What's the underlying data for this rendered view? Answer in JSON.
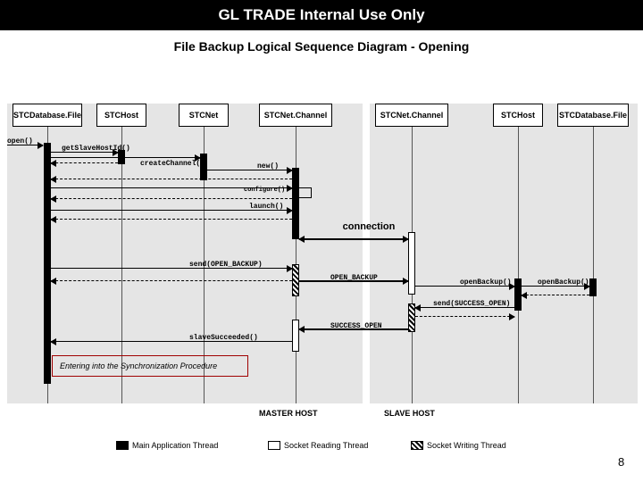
{
  "header": {
    "title": "GL TRADE Internal Use Only"
  },
  "subtitle": "File Backup Logical Sequence Diagram - Opening",
  "participants": [
    {
      "id": "p0",
      "label": "STCDatabase.File"
    },
    {
      "id": "p1",
      "label": "STCHost"
    },
    {
      "id": "p2",
      "label": "STCNet"
    },
    {
      "id": "p3",
      "label": "STCNet.Channel"
    },
    {
      "id": "p4",
      "label": "STCNet.Channel"
    },
    {
      "id": "p5",
      "label": "STCHost"
    },
    {
      "id": "p6",
      "label": "STCDatabase.File"
    }
  ],
  "messages": {
    "open": "open()",
    "getSlaveHostId": "getSlaveHostId()",
    "createChannel": "createChannel()",
    "new": "new()",
    "configure": "configure()",
    "launch": "launch()",
    "connection": "connection",
    "sendOpenBackup": "send(OPEN_BACKUP)",
    "openBackup": "OPEN_BACKUP",
    "openBackupCall": "openBackup()",
    "sendSuccessOpen": "send(SUCCESS_OPEN)",
    "successOpen": "SUCCESS_OPEN",
    "slaveSucceeded": "slaveSucceeded()"
  },
  "note": "Entering into the Synchronization Procedure",
  "hostLabels": {
    "master": "MASTER HOST",
    "slave": "SLAVE HOST"
  },
  "legend": {
    "main": "Main Application Thread",
    "read": "Socket Reading Thread",
    "write": "Socket Writing Thread"
  },
  "pageNumber": "8"
}
